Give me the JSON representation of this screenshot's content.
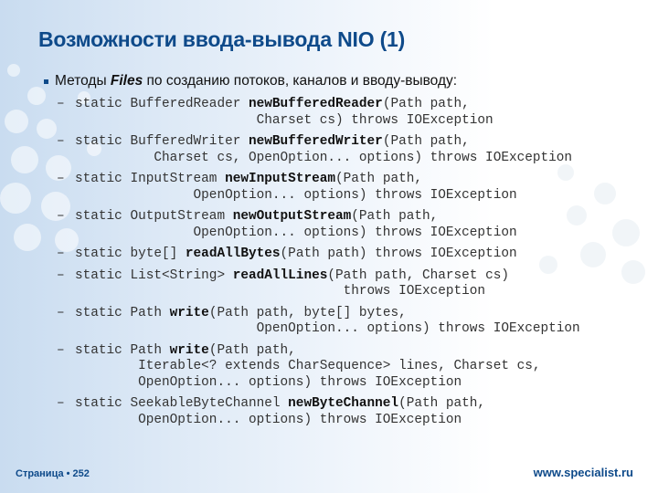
{
  "slide": {
    "title": "Возможности ввода-вывода NIO (1)",
    "intro": {
      "prefix": "Методы ",
      "emphasis": "Files",
      "suffix": " по созданию потоков, каналов и вводу-выводу:"
    },
    "methods": [
      {
        "pre": "static BufferedReader ",
        "name": "newBufferedReader",
        "post": "(Path path,\n                       Charset cs) throws IOException"
      },
      {
        "pre": "static BufferedWriter ",
        "name": "newBufferedWriter",
        "post": "(Path path,\n          Charset cs, OpenOption... options) throws IOException"
      },
      {
        "pre": "static InputStream ",
        "name": "newInputStream",
        "post": "(Path path,\n               OpenOption... options) throws IOException"
      },
      {
        "pre": "static OutputStream ",
        "name": "newOutputStream",
        "post": "(Path path,\n               OpenOption... options) throws IOException"
      },
      {
        "pre": "static byte[] ",
        "name": "readAllBytes",
        "post": "(Path path) throws IOException"
      },
      {
        "pre": "static List<String> ",
        "name": "readAllLines",
        "post": "(Path path, Charset cs)\n                                  throws IOException"
      },
      {
        "pre": "static Path ",
        "name": "write",
        "post": "(Path path, byte[] bytes,\n                       OpenOption... options) throws IOException"
      },
      {
        "pre": "static Path ",
        "name": "write",
        "post": "(Path path,\n        Iterable<? extends CharSequence> lines, Charset cs,\n        OpenOption... options) throws IOException"
      },
      {
        "pre": "static SeekableByteChannel ",
        "name": "newByteChannel",
        "post": "(Path path,\n        OpenOption... options) throws IOException"
      }
    ],
    "dash": "–"
  },
  "footer": {
    "page_label": "Страница • 252",
    "website": "www.specialist.ru"
  },
  "colors": {
    "accent": "#0e4a8a"
  }
}
